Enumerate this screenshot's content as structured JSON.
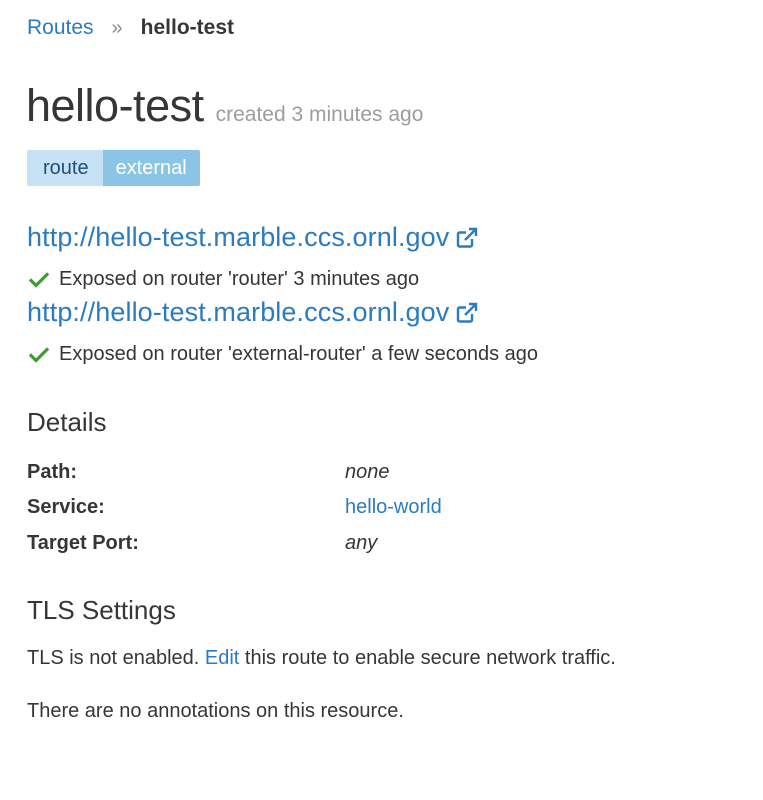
{
  "breadcrumb": {
    "parent": "Routes",
    "separator": "»",
    "current": "hello-test"
  },
  "header": {
    "title": "hello-test",
    "created": "created 3 minutes ago"
  },
  "labels": {
    "key": "route",
    "value": "external"
  },
  "ingress": [
    {
      "url": "http://hello-test.marble.ccs.ornl.gov",
      "status": "Exposed on router 'router' 3 minutes ago"
    },
    {
      "url": "http://hello-test.marble.ccs.ornl.gov",
      "status": "Exposed on router 'external-router' a few seconds ago"
    }
  ],
  "details": {
    "heading": "Details",
    "path_label": "Path:",
    "path_value": "none",
    "service_label": "Service:",
    "service_value": "hello-world",
    "port_label": "Target Port:",
    "port_value": "any"
  },
  "tls": {
    "heading": "TLS Settings",
    "text_before": "TLS is not enabled. ",
    "edit_link": "Edit",
    "text_after": " this route to enable secure network traffic."
  },
  "annotations": {
    "empty_text": "There are no annotations on this resource."
  },
  "colors": {
    "link": "#2b7bc0",
    "success": "#3f9c35",
    "label_key_bg": "#c7e2f4",
    "label_value_bg": "#8cc4e6"
  },
  "icons": {
    "external": "external-link-icon",
    "check": "check-icon"
  }
}
